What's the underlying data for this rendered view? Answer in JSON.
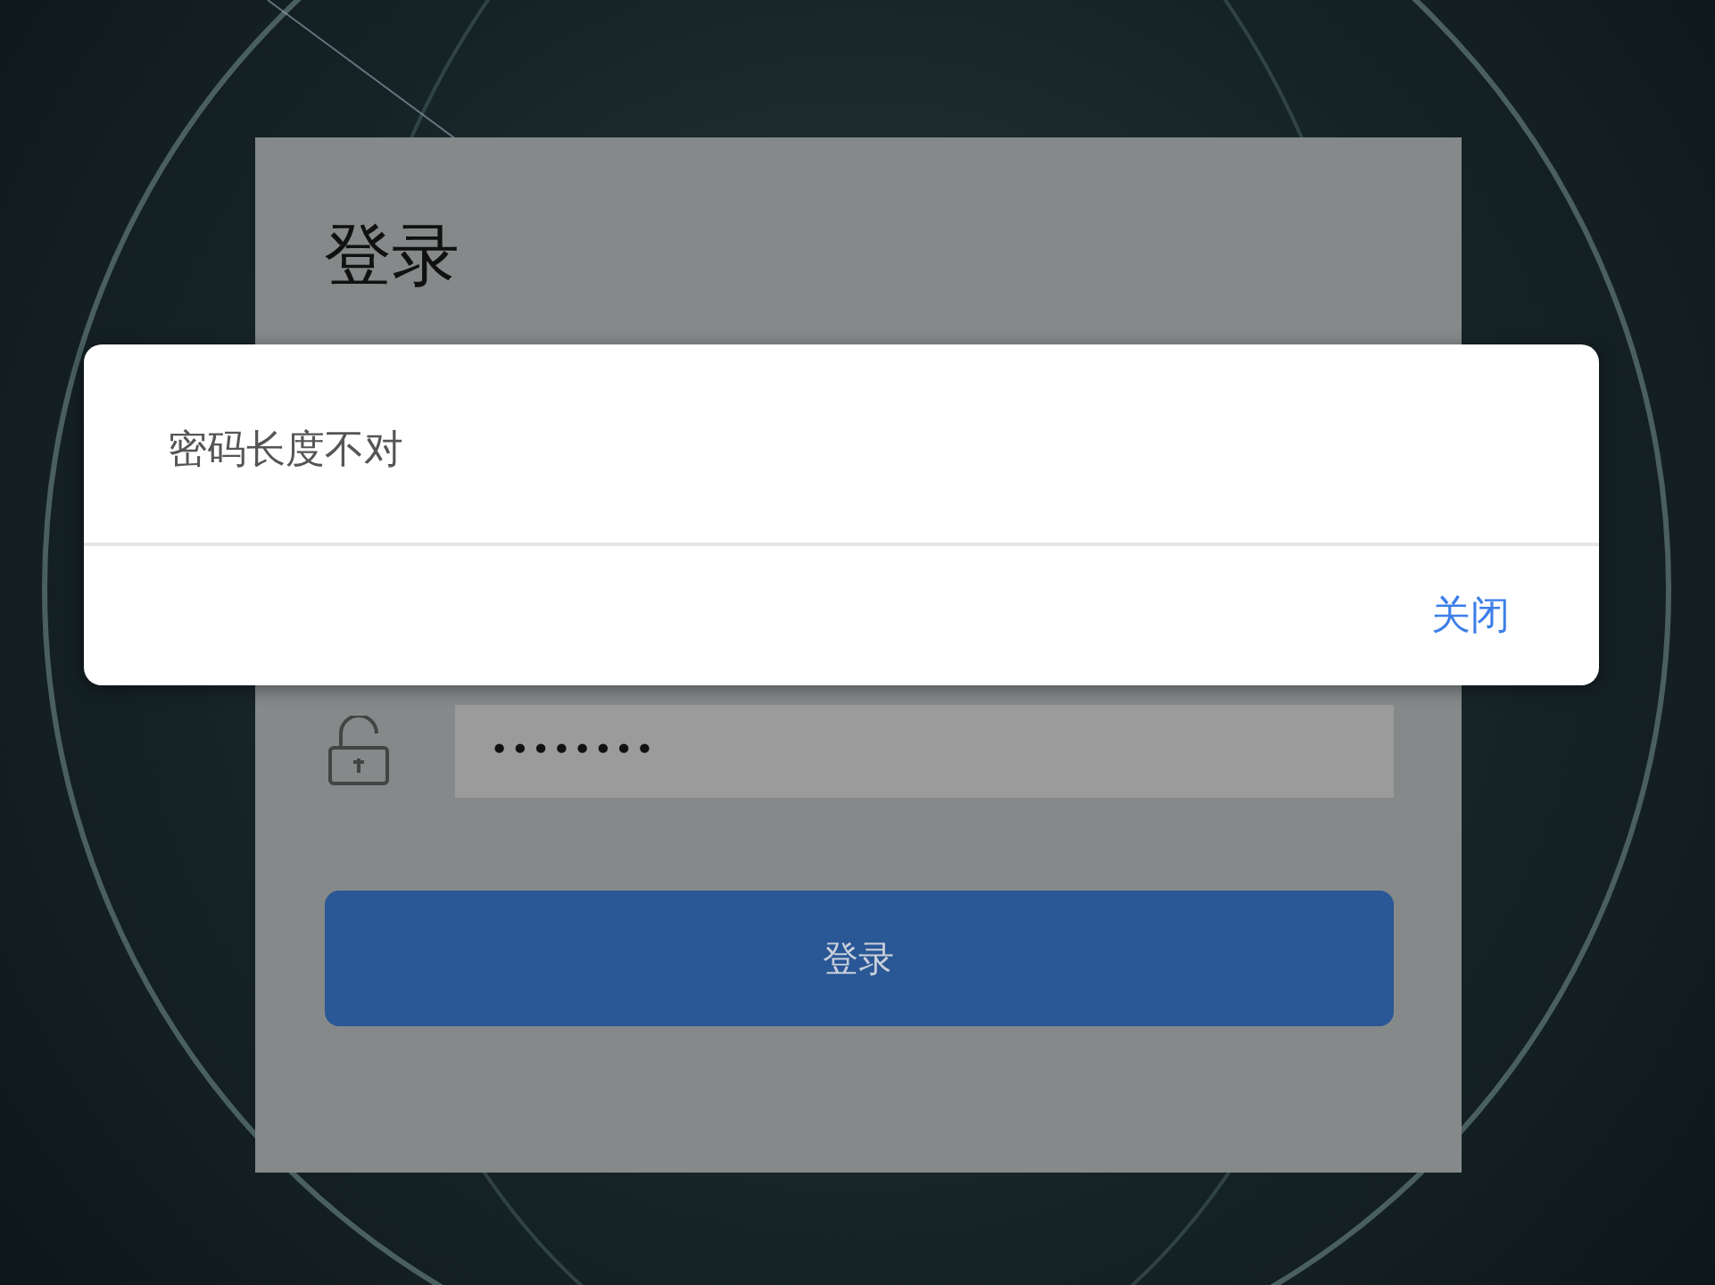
{
  "login_card": {
    "title": "登录",
    "password_field": {
      "value": "••••••••"
    },
    "login_button": {
      "label": "登录"
    }
  },
  "alert_dialog": {
    "message": "密码长度不对",
    "buttons": [
      "关闭"
    ]
  }
}
